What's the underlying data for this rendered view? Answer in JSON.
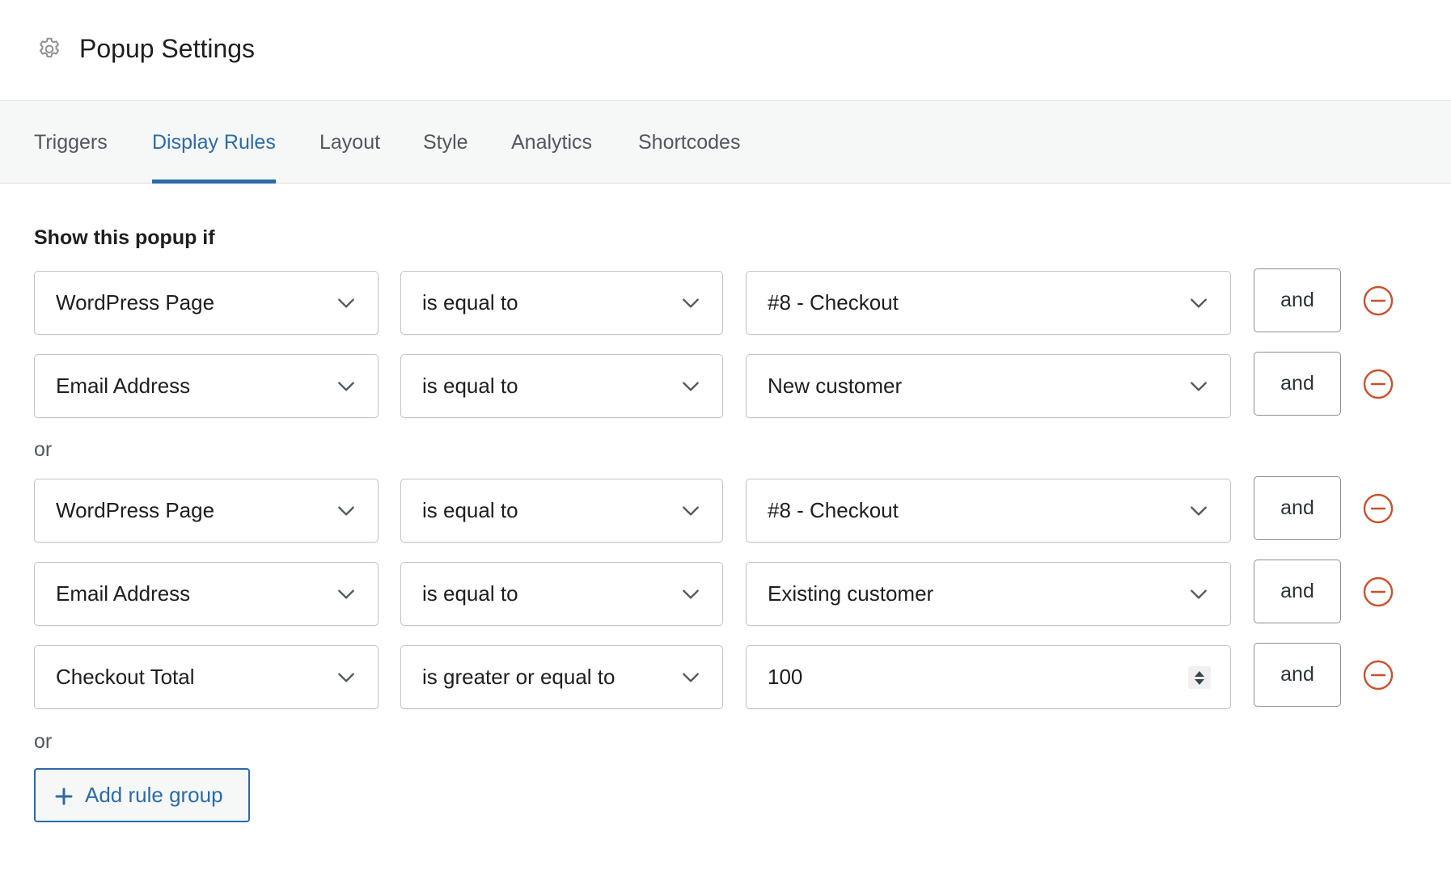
{
  "header": {
    "title": "Popup Settings",
    "icon": "gear-icon"
  },
  "tabs": [
    {
      "label": "Triggers",
      "active": false
    },
    {
      "label": "Display Rules",
      "active": true
    },
    {
      "label": "Layout",
      "active": false
    },
    {
      "label": "Style",
      "active": false
    },
    {
      "label": "Analytics",
      "active": false
    },
    {
      "label": "Shortcodes",
      "active": false
    }
  ],
  "rules": {
    "intro": "Show this popup if",
    "or_label": "or",
    "and_label": "and",
    "groups": [
      {
        "rows": [
          {
            "field": "WordPress Page",
            "operator": "is equal to",
            "value": "#8 - Checkout",
            "value_type": "select"
          },
          {
            "field": "Email Address",
            "operator": "is equal to",
            "value": "New customer",
            "value_type": "select"
          }
        ]
      },
      {
        "rows": [
          {
            "field": "WordPress Page",
            "operator": "is equal to",
            "value": "#8 - Checkout",
            "value_type": "select"
          },
          {
            "field": "Email Address",
            "operator": "is equal to",
            "value": "Existing customer",
            "value_type": "select"
          },
          {
            "field": "Checkout Total",
            "operator": "is greater or equal to",
            "value": "100",
            "value_type": "number"
          }
        ]
      }
    ]
  },
  "add_group_button": {
    "label": "Add rule group",
    "icon": "plus-icon"
  },
  "colors": {
    "accent": "#2c6ba8",
    "remove": "#c9502f",
    "border": "#c3c4c7"
  }
}
